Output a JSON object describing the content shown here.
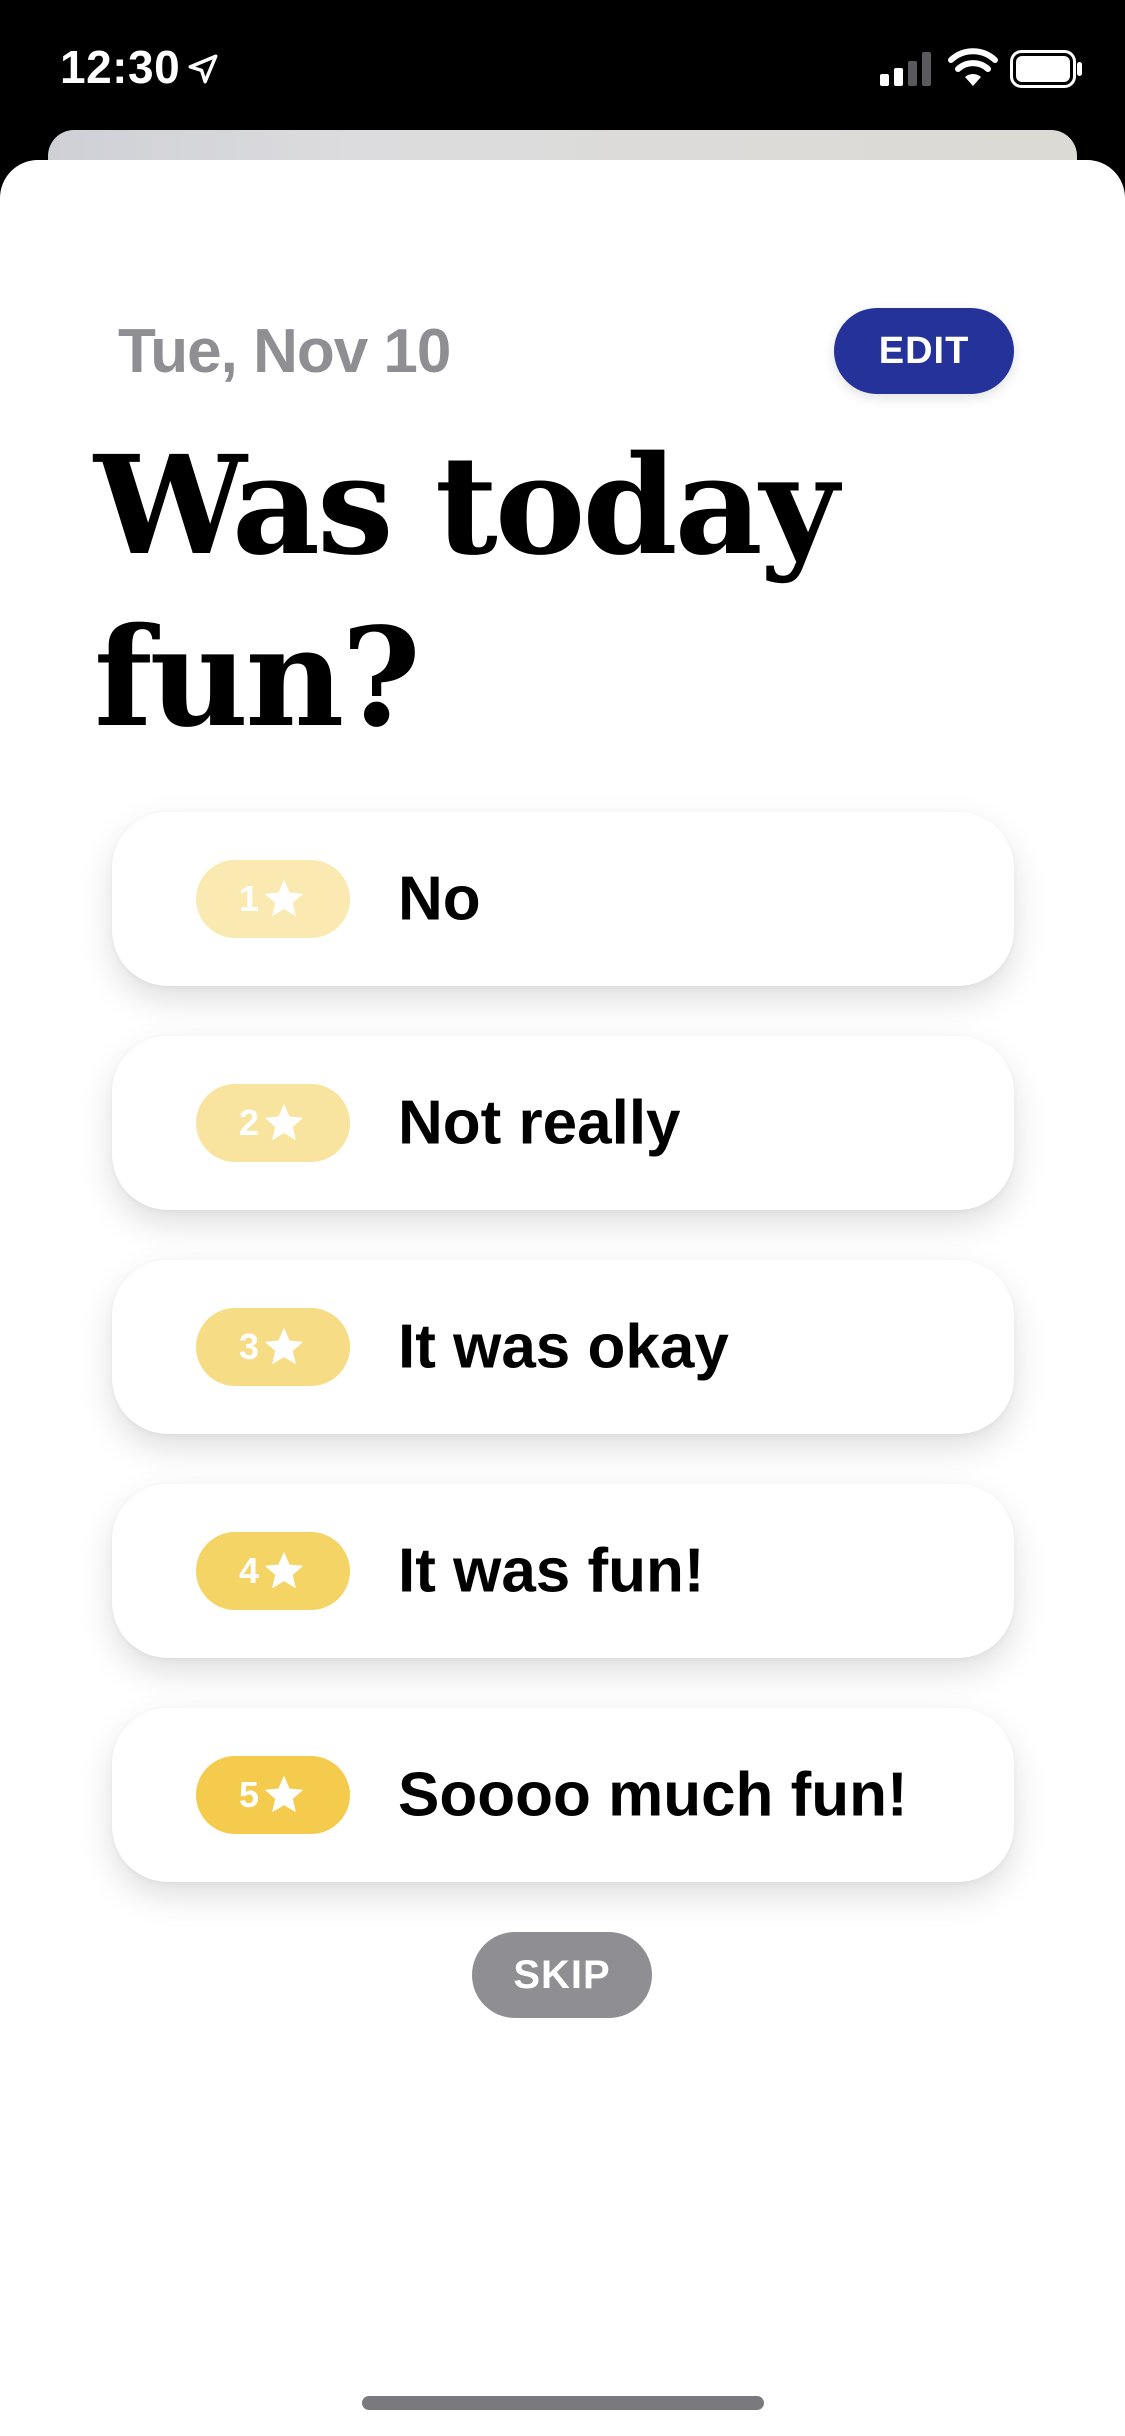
{
  "status_bar": {
    "time": "12:30",
    "icons": [
      "location-arrow-icon",
      "cellular-signal-icon",
      "wifi-icon",
      "battery-icon"
    ]
  },
  "header": {
    "date": "Tue, Nov 10",
    "edit_label": "EDIT",
    "edit_color": "#24329a"
  },
  "title": {
    "line1": "Was today",
    "line2": "fun?"
  },
  "options": [
    {
      "rating": "1",
      "label": "No",
      "badge_color": "#fae9b0"
    },
    {
      "rating": "2",
      "label": "Not really",
      "badge_color": "#f8e39f"
    },
    {
      "rating": "3",
      "label": "It was okay",
      "badge_color": "#f7dc86"
    },
    {
      "rating": "4",
      "label": "It was fun!",
      "badge_color": "#f5d466"
    },
    {
      "rating": "5",
      "label": "Soooo much fun!",
      "badge_color": "#f4cb4d"
    }
  ],
  "skip_label": "SKIP",
  "skip_color": "#8e8e93"
}
